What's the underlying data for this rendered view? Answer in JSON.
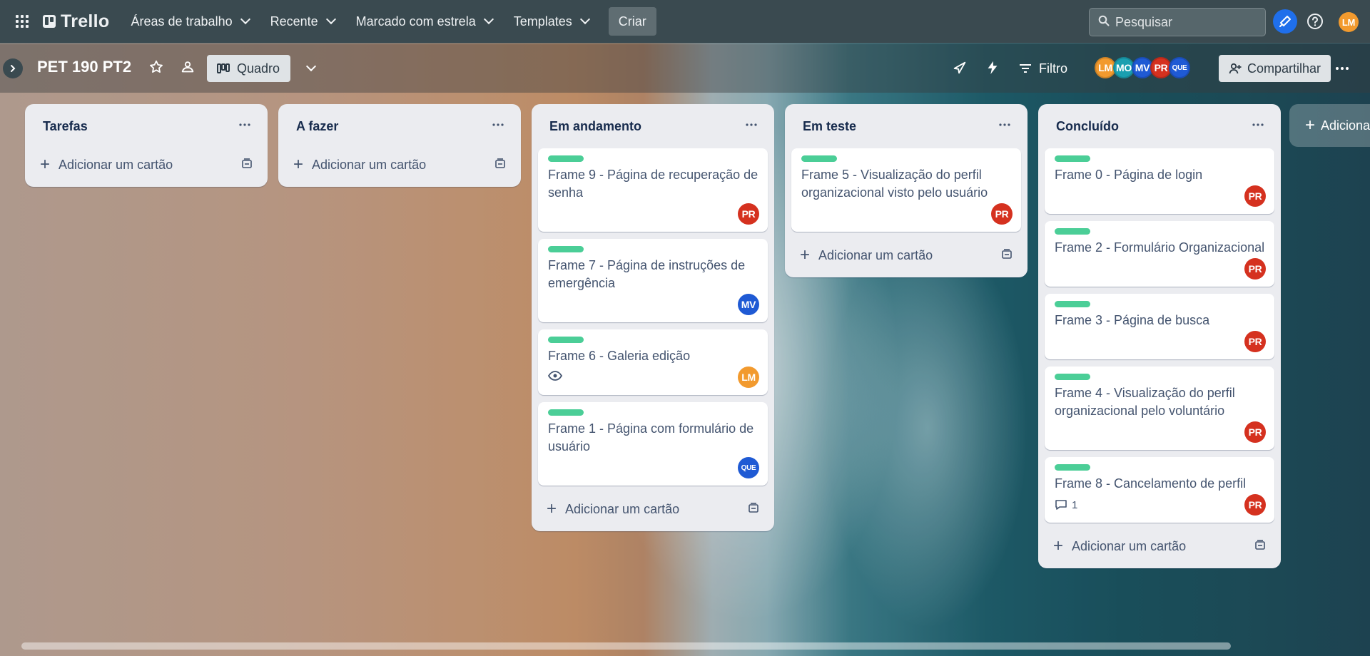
{
  "colors": {
    "card_label_green": "#4bce97",
    "avatar_PR": "#d5311f",
    "avatar_MV": "#1f5ad4",
    "avatar_LM": "#f29a2e",
    "avatar_MO": "#1a9fb0",
    "avatar_QUE": "#1f5ad4",
    "notify_blue": "#1f6feb"
  },
  "topnav": {
    "apps_icon": "grid-icon",
    "logo": "Trello",
    "menus": [
      {
        "label": "Áreas de trabalho"
      },
      {
        "label": "Recente"
      },
      {
        "label": "Marcado com estrela"
      },
      {
        "label": "Templates"
      }
    ],
    "create_label": "Criar",
    "search_placeholder": "Pesquisar",
    "user_initials": "LM"
  },
  "board": {
    "title": "PET 190 PT2",
    "view_label": "Quadro",
    "filter_label": "Filtro",
    "share_label": "Compartilhar",
    "members": [
      {
        "initials": "LM"
      },
      {
        "initials": "MO"
      },
      {
        "initials": "MV"
      },
      {
        "initials": "PR"
      },
      {
        "initials": "QUE"
      }
    ],
    "add_list_label": "Adiciona"
  },
  "lists": [
    {
      "title": "Tarefas",
      "add_card_label": "Adicionar um cartão",
      "cards": []
    },
    {
      "title": "A fazer",
      "add_card_label": "Adicionar um cartão",
      "cards": []
    },
    {
      "title": "Em andamento",
      "add_card_label": "Adicionar um cartão",
      "cards": [
        {
          "title": "Frame 9 - Página de recuperação de senha",
          "member": "PR"
        },
        {
          "title": "Frame 7 - Página de instruções de emergência",
          "member": "MV"
        },
        {
          "title": "Frame 6 - Galeria edição",
          "member": "LM",
          "watch": true
        },
        {
          "title": "Frame 1 - Página com formulário de usuário",
          "member": "QUE"
        }
      ]
    },
    {
      "title": "Em teste",
      "add_card_label": "Adicionar um cartão",
      "cards": [
        {
          "title": "Frame 5 - Visualização do perfil organizacional visto pelo usuário",
          "member": "PR"
        }
      ]
    },
    {
      "title": "Concluído",
      "add_card_label": "Adicionar um cartão",
      "cards": [
        {
          "title": "Frame 0 - Página de login",
          "member": "PR"
        },
        {
          "title": "Frame 2 - Formulário Organizacional",
          "member": "PR"
        },
        {
          "title": "Frame 3 - Página de busca",
          "member": "PR"
        },
        {
          "title": "Frame 4 - Visualização do perfil organizacional pelo voluntário",
          "member": "PR"
        },
        {
          "title": "Frame 8 - Cancelamento de perfil",
          "member": "PR",
          "comments": "1"
        }
      ]
    }
  ]
}
